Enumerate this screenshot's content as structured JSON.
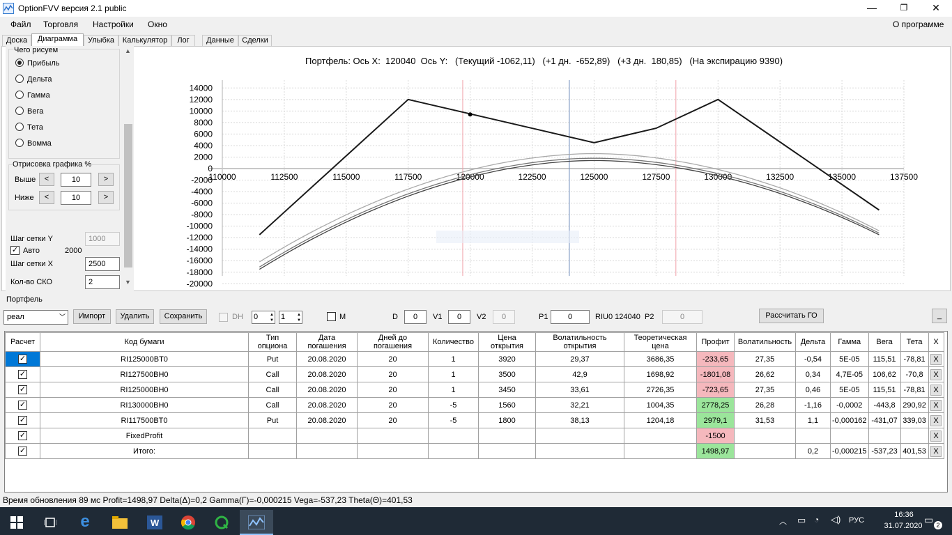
{
  "window": {
    "title": "OptionFVV версия 2.1 public",
    "controls": {
      "minimize": "—",
      "maximize": "❐",
      "close": "✕"
    }
  },
  "menu": {
    "items": [
      "Файл",
      "Торговля",
      "Настройки",
      "Окно"
    ],
    "about": "О программе"
  },
  "tabs": [
    "Доска",
    "Диаграмма",
    "Улыбка",
    "Калькулятор",
    "Лог",
    "Данные",
    "Сделки"
  ],
  "active_tab": "Диаграмма",
  "left_panel": {
    "draw_group_label": "Чего рисуем",
    "radios": [
      "Прибыль",
      "Дельта",
      "Гамма",
      "Вега",
      "Тета",
      "Вомма"
    ],
    "selected_radio": "Прибыль",
    "plot_group_label": "Отрисовка графика %",
    "above_label": "Выше",
    "above_value": "10",
    "below_label": "Ниже",
    "below_value": "10",
    "left_btn": "<",
    "right_btn": ">",
    "grid_y_label": "Шаг сетки Y",
    "grid_y_value": "1000",
    "auto_label": "Авто",
    "auto_value": "2000",
    "grid_x_label": "Шаг сетки X",
    "grid_x_value": "2500",
    "sko_label": "Кол-во СКО",
    "sko_value": "2"
  },
  "chart_title": "Портфель: Ось X:  120040  Ось Y:   (Текущий -1062,11)   (+1 дн.  -652,89)   (+3 дн.  180,85)   (На экспирацию 9390)",
  "chart_data": {
    "type": "line",
    "x_ticks": [
      "110000",
      "112500",
      "115000",
      "117500",
      "120000",
      "122500",
      "125000",
      "127500",
      "130000",
      "132500",
      "135000",
      "137500"
    ],
    "y_ticks": [
      "14000",
      "12000",
      "10000",
      "8000",
      "6000",
      "4000",
      "2000",
      "0",
      "-2000",
      "-4000",
      "-6000",
      "-8000",
      "-10000",
      "-12000",
      "-14000",
      "-16000",
      "-18000",
      "-20000"
    ],
    "xlim": [
      110000,
      137500
    ],
    "ylim": [
      -20000,
      15000
    ],
    "grid": true,
    "current_x": 120040,
    "center_line_x": 124000,
    "sigma_lines_x": [
      119700,
      128300
    ],
    "expiration": {
      "x": [
        111500,
        117500,
        125000,
        127500,
        130000,
        136500
      ],
      "y": [
        -11500,
        12000,
        4500,
        7000,
        12000,
        -7200
      ],
      "color": "#1a1a1a"
    },
    "current_point": {
      "x": 120000,
      "y": 9400
    },
    "curves": [
      {
        "label": "Текущий",
        "peak_x": 125000,
        "peak_y": 1400,
        "left": [
          111500,
          -17500
        ],
        "right": [
          136500,
          -11500
        ],
        "color": "#444444"
      },
      {
        "label": "+1 дн.",
        "peak_x": 125000,
        "peak_y": 1800,
        "left": [
          111500,
          -17100
        ],
        "right": [
          136500,
          -11200
        ],
        "color": "#777777"
      },
      {
        "label": "+3 дн.",
        "peak_x": 125000,
        "peak_y": 2600,
        "left": [
          111500,
          -16200
        ],
        "right": [
          136500,
          -10800
        ],
        "color": "#aaaaaa"
      }
    ]
  },
  "portfolio": {
    "label": "Портфель",
    "combo_value": "реал",
    "import_btn": "Импорт",
    "delete_btn": "Удалить",
    "save_btn": "Сохранить",
    "dh_label": "DH",
    "spin1": "0",
    "spin2": "1",
    "m_label": "M",
    "d_label": "D",
    "d_value": "0",
    "v1_label": "V1",
    "v1_value": "0",
    "v2_label": "V2",
    "v2_value": "0",
    "p1_label": "P1",
    "p1_value": "0",
    "riu_label": "RIU0 124040",
    "p2_label": "P2",
    "p2_value": "0",
    "calc_btn": "Рассчитать ГО",
    "collapse_btn": "_"
  },
  "table": {
    "headers": [
      "Расчет",
      "Код бумаги",
      "Тип\nопциона",
      "Дата\nпогашения",
      "Дней до\nпогашения",
      "Количество",
      "Цена\nоткрытия",
      "Волатильность\nоткрытия",
      "Теоретическая\nцена",
      "Профит",
      "Волатильность",
      "Дельта",
      "Гамма",
      "Вега",
      "Тета",
      "X"
    ],
    "rows": [
      [
        "RI125000BT0",
        "Put",
        "20.08.2020",
        "20",
        "1",
        "3920",
        "29,37",
        "3686,35",
        "-233,65",
        "27,35",
        "-0,54",
        "5E-05",
        "115,51",
        "-78,81",
        "X"
      ],
      [
        "RI127500BH0",
        "Call",
        "20.08.2020",
        "20",
        "1",
        "3500",
        "42,9",
        "1698,92",
        "-1801,08",
        "26,62",
        "0,34",
        "4,7E-05",
        "106,62",
        "-70,8",
        "X"
      ],
      [
        "RI125000BH0",
        "Call",
        "20.08.2020",
        "20",
        "1",
        "3450",
        "33,61",
        "2726,35",
        "-723,65",
        "27,35",
        "0,46",
        "5E-05",
        "115,51",
        "-78,81",
        "X"
      ],
      [
        "RI130000BH0",
        "Call",
        "20.08.2020",
        "20",
        "-5",
        "1560",
        "32,21",
        "1004,35",
        "2778,25",
        "26,28",
        "-1,16",
        "-0,0002",
        "-443,8",
        "290,92",
        "X"
      ],
      [
        "RI117500BT0",
        "Put",
        "20.08.2020",
        "20",
        "-5",
        "1800",
        "38,13",
        "1204,18",
        "2979,1",
        "31,53",
        "1,1",
        "-0,000162",
        "-431,07",
        "339,03",
        "X"
      ],
      [
        "FixedProfit",
        "",
        "",
        "",
        "",
        "",
        "",
        "",
        "-1500",
        "",
        "",
        "",
        "",
        "",
        "X"
      ],
      [
        "Итого:",
        "",
        "",
        "",
        "",
        "",
        "",
        "",
        "1498,97",
        "",
        "0,2",
        "-0,000215",
        "-537,23",
        "401,53",
        "X"
      ]
    ],
    "profit_sign": [
      "neg",
      "neg",
      "neg",
      "pos",
      "pos",
      "neg",
      "pos"
    ]
  },
  "status": "Время обновления 89 мс   Profit=1498,97 Delta(Δ)=0,2 Gamma(Γ)=-0,000215 Vega=-537,23 Theta(Θ)=401,53",
  "taskbar": {
    "lang": "РУС",
    "time": "16:36",
    "date": "31.07.2020",
    "notif_count": "2"
  }
}
